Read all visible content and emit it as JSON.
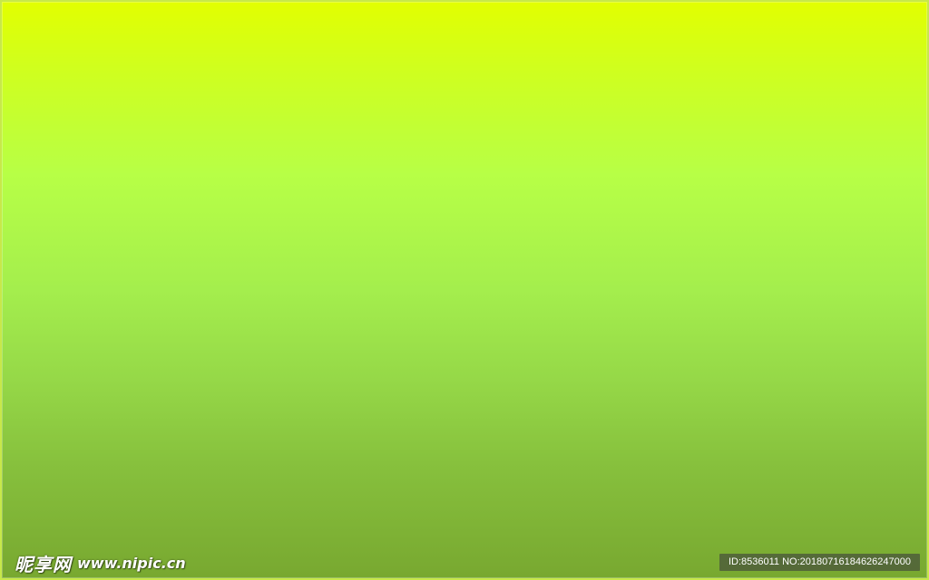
{
  "background": {
    "gradient_colors": [
      "#e2ff00",
      "#b7ff46",
      "#a4ee4d",
      "#87c13d",
      "#78a830"
    ]
  },
  "watermark": {
    "logo_text": "昵享网",
    "url_text": "www.nipic.cn",
    "id_text": "ID:8536011 NO:20180716184626247000"
  }
}
